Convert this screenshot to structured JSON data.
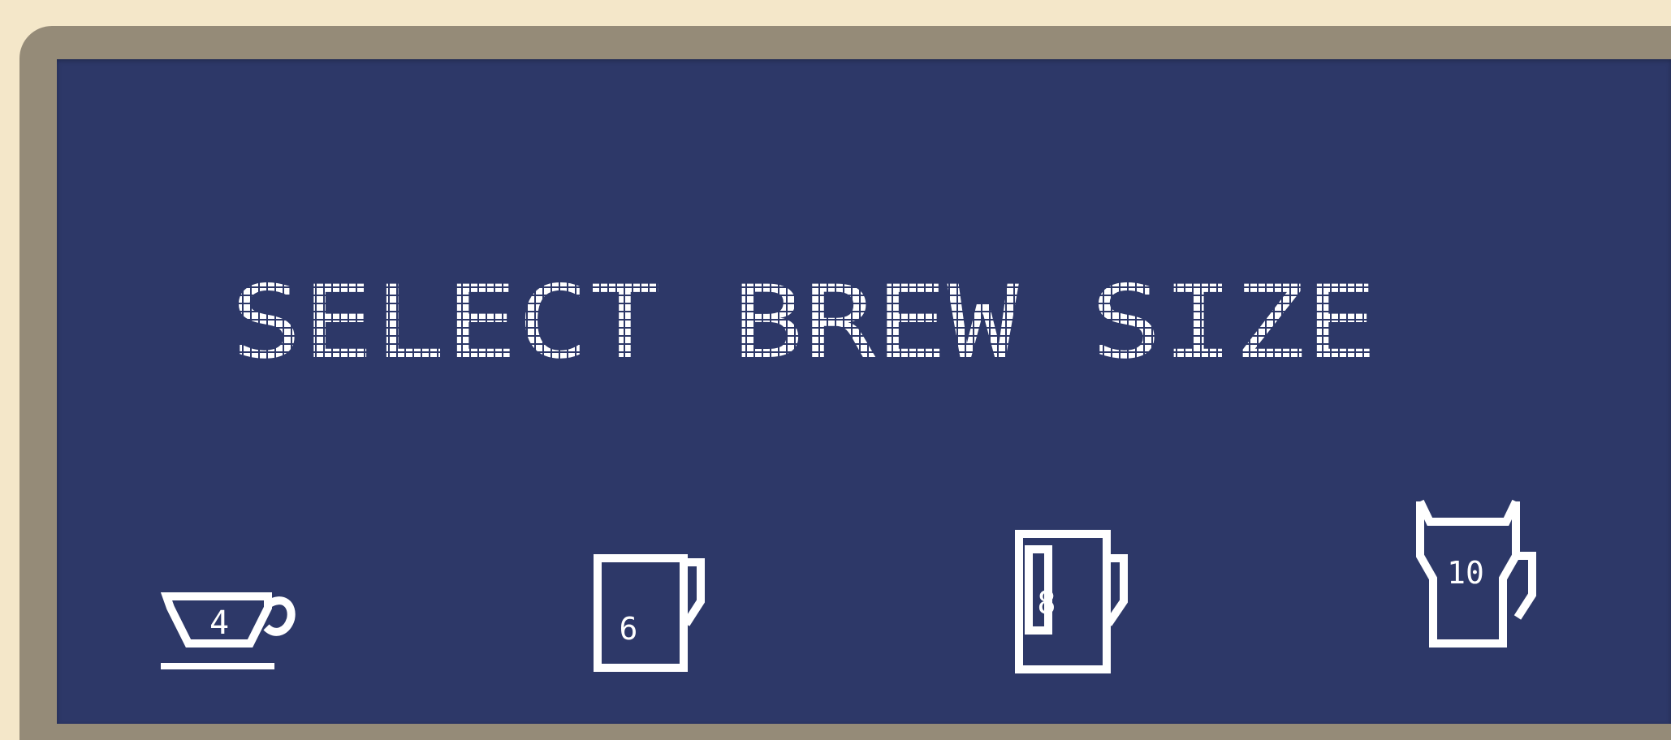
{
  "display": {
    "prompt": "SELECT BREW SIZE",
    "text_color": "#ffffff",
    "screen_color": "#2d3868",
    "bezel_color": "#958b78",
    "background_color": "#f4e7c9"
  },
  "sizes": [
    {
      "label": "4",
      "icon": "cup-icon"
    },
    {
      "label": "6",
      "icon": "mug-icon"
    },
    {
      "label": "8",
      "icon": "tall-mug-icon"
    },
    {
      "label": "10",
      "icon": "travel-mug-icon"
    }
  ]
}
